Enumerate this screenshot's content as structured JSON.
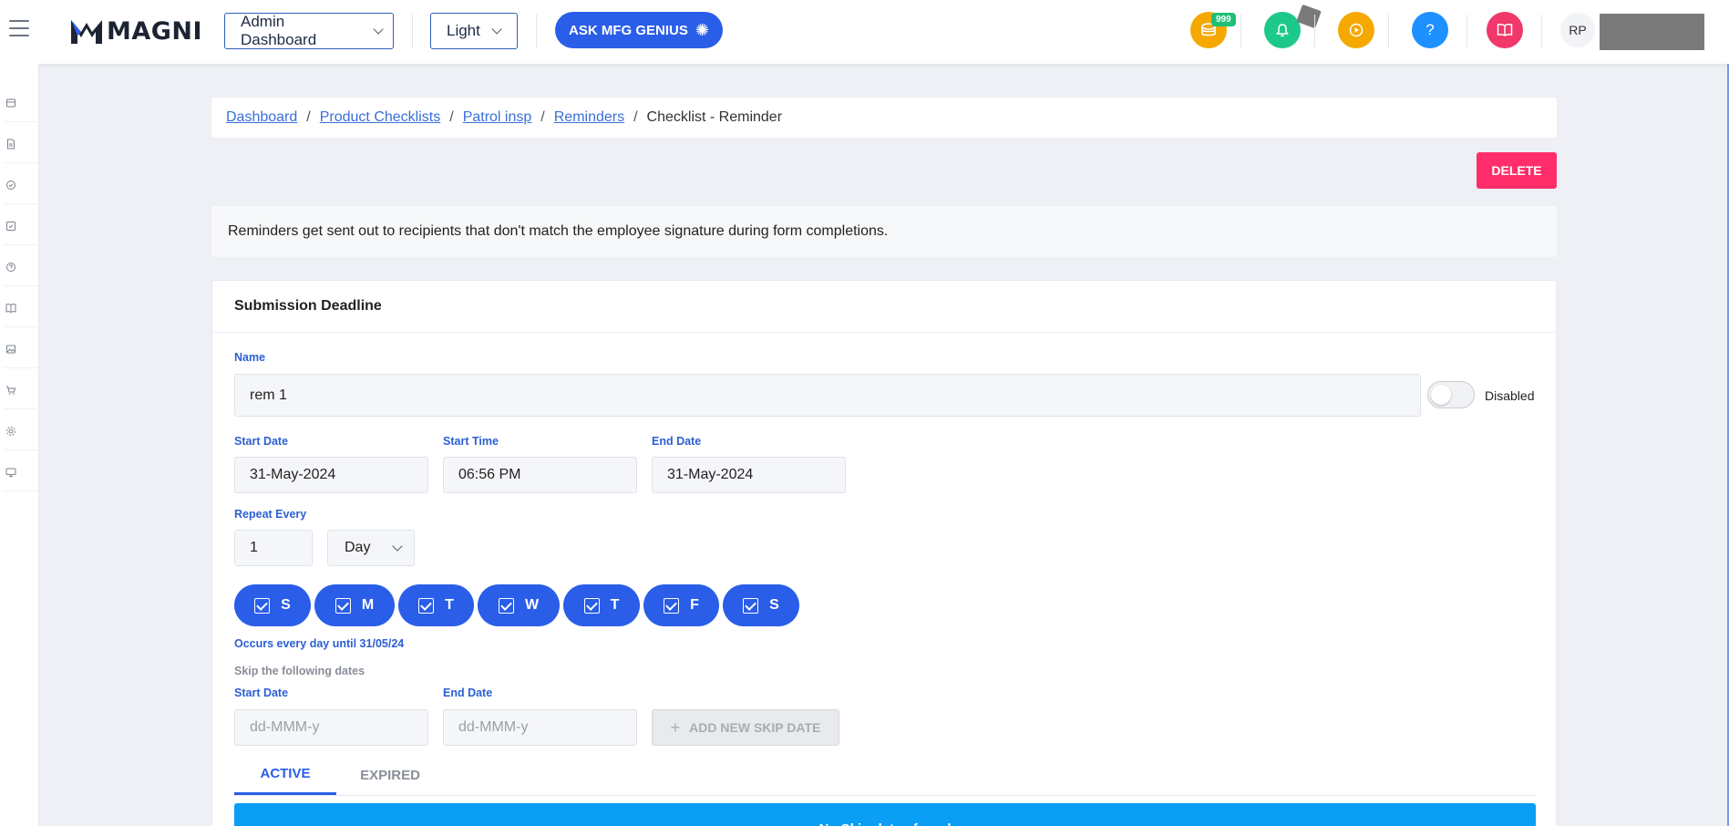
{
  "header": {
    "logo_text": "MAGNI",
    "dashboard_select": "Admin Dashboard",
    "theme_select": "Light",
    "ask_button": "ASK MFG GENIUS",
    "coins_badge": "999",
    "avatar_initials": "RP"
  },
  "breadcrumb": {
    "items": [
      "Dashboard",
      "Product Checklists",
      "Patrol insp",
      "Reminders"
    ],
    "current": "Checklist - Reminder"
  },
  "actions": {
    "delete_label": "DELETE"
  },
  "info_text": "Reminders get sent out to recipients that don't match the employee signature during form completions.",
  "form": {
    "section_title": "Submission Deadline",
    "name_label": "Name",
    "name_value": "rem 1",
    "toggle_label": "Disabled",
    "start_date_label": "Start Date",
    "start_date_value": "31-May-2024",
    "start_time_label": "Start Time",
    "start_time_value": "06:56 PM",
    "end_date_label": "End Date",
    "end_date_value": "31-May-2024",
    "repeat_label": "Repeat Every",
    "repeat_value": "1",
    "repeat_unit": "Day",
    "days": [
      "S",
      "M",
      "T",
      "W",
      "T",
      "F",
      "S"
    ],
    "occurs_text": "Occurs every day until 31/05/24",
    "skip_label": "Skip the following dates",
    "skip_start_label": "Start Date",
    "skip_start_placeholder": "dd-MMM-y",
    "skip_end_label": "End Date",
    "skip_end_placeholder": "dd-MMM-y",
    "add_skip_label": "ADD NEW SKIP DATE",
    "tabs": [
      "ACTIVE",
      "EXPIRED"
    ],
    "empty_message": "No Skip dates found"
  },
  "colors": {
    "primary": "#2a5de8",
    "danger": "#ff2e6b",
    "info": "#0b9ef5",
    "coins": "#f5a800",
    "bell": "#1cc88a",
    "play": "#f5a800",
    "help": "#1e90ff",
    "book": "#f0386b"
  },
  "icons": [
    "menu-icon",
    "coins-icon",
    "bell-icon",
    "play-icon",
    "help-icon",
    "book-icon",
    "sparkle-icon"
  ]
}
